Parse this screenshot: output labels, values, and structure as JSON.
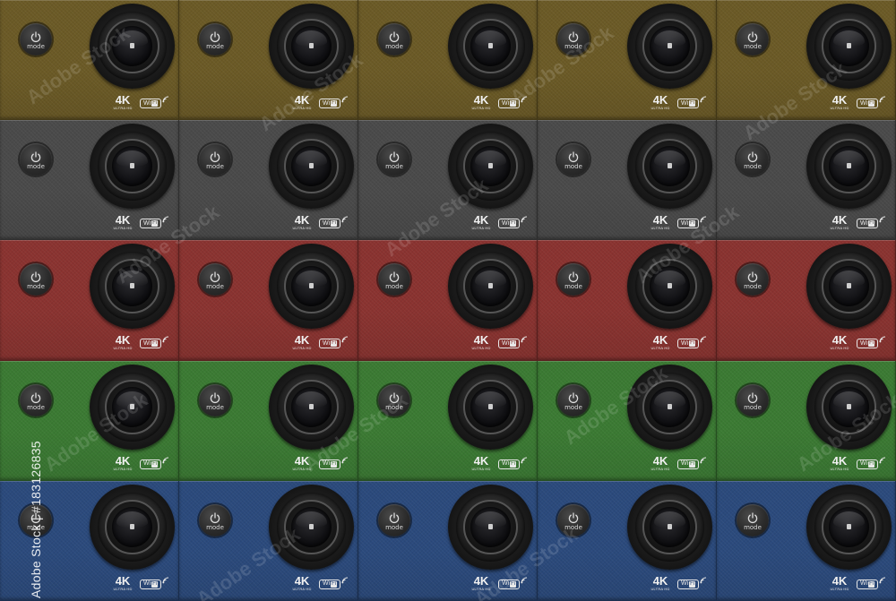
{
  "labels": {
    "power_button": "mode",
    "resolution": "4K",
    "resolution_sub": "ULTRA HD",
    "wifi_left": "Wi",
    "wifi_right": "Fi"
  },
  "body_colors": [
    {
      "name": "olive-brown",
      "hex": "#6b5a26"
    },
    {
      "name": "dark-gray",
      "hex": "#4a4a4a"
    },
    {
      "name": "dark-red",
      "hex": "#8a3330"
    },
    {
      "name": "green",
      "hex": "#3b7a33"
    },
    {
      "name": "navy-blue",
      "hex": "#2b4a7c"
    }
  ],
  "cameras_per_row": 5,
  "watermark": {
    "stock_id_text": "Adobe Stock | #183126835",
    "logo_text": "Adobe Stock"
  },
  "icons": {
    "power": "power-icon",
    "wifi": "wifi-icon",
    "lens": "camera-lens-icon"
  }
}
